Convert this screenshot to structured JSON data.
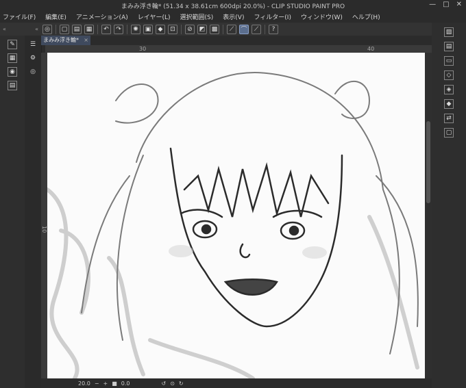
{
  "window": {
    "title": "まみみ浮き輪* (51.34 x 38.61cm 600dpi 20.0%) - CLIP STUDIO PAINT PRO",
    "min": "—",
    "max": "□",
    "close": "✕"
  },
  "menu": [
    "ファイル(F)",
    "編集(E)",
    "アニメーション(A)",
    "レイヤー(L)",
    "選択範囲(S)",
    "表示(V)",
    "フィルター(I)",
    "ウィンドウ(W)",
    "ヘルプ(H)"
  ],
  "tab": {
    "label": "まみみ浮き輪*",
    "close": "×"
  },
  "ruler": {
    "top_labels": [
      "30",
      "40"
    ],
    "left_label": "10"
  },
  "status": {
    "zoom": "20.0",
    "minus": "−",
    "plus": "+",
    "angle": "0.0"
  },
  "toolbar": {
    "collapse_left": "«",
    "collapse_right": "«"
  }
}
